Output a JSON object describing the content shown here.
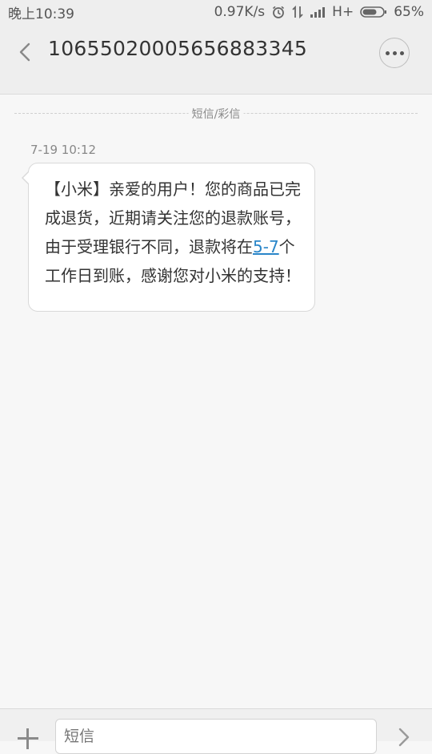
{
  "status_bar": {
    "time": "晚上10:39",
    "speed": "0.97K/s",
    "network": "H+",
    "battery": "65%",
    "icons": [
      "alarm-icon",
      "data-transfer-icon",
      "signal-icon",
      "battery-icon"
    ]
  },
  "header": {
    "title": "10655020005656883345",
    "back_icon": "chevron-left-icon",
    "more_icon": "more-dots-icon"
  },
  "conversation": {
    "divider_label": "短信/彩信",
    "messages": [
      {
        "time": "7-19 10:12",
        "text_before": "【小米】亲爱的用户！您的商品已完成退货，近期请关注您的退款账号，由于受理银行不同，退款将在",
        "link": "5-7",
        "text_after": "个工作日到账，感谢您对小米的支持！"
      }
    ]
  },
  "input_bar": {
    "placeholder": "短信",
    "add_icon": "plus-icon",
    "send_icon": "send-chevron-icon"
  },
  "colors": {
    "link": "#2a86c9",
    "bubble_bg": "#ffffff",
    "background": "#f7f7f7"
  }
}
